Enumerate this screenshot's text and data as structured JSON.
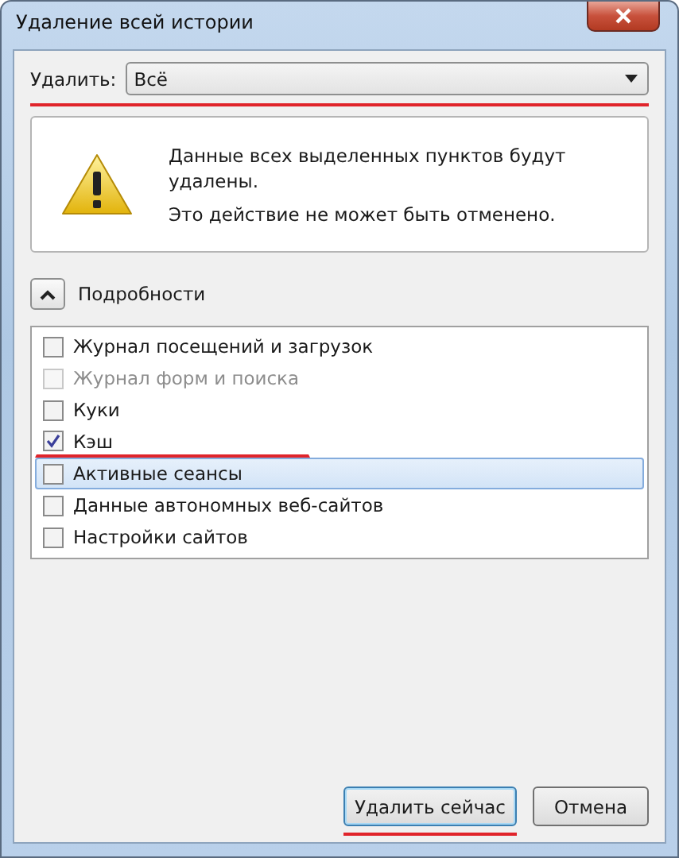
{
  "window": {
    "title": "Удаление всей истории"
  },
  "range": {
    "label": "Удалить:",
    "value": "Всё",
    "annotated": true
  },
  "warning": {
    "lines": [
      "Данные всех выделенных пунктов будут удалены.",
      "Это действие не может быть отменено."
    ]
  },
  "details": {
    "label": "Подробности",
    "expanded": true
  },
  "items": [
    {
      "label": "Журнал посещений и загрузок",
      "checked": false,
      "disabled": false,
      "selected": false,
      "annotated": false
    },
    {
      "label": "Журнал форм и поиска",
      "checked": false,
      "disabled": true,
      "selected": false,
      "annotated": false
    },
    {
      "label": "Куки",
      "checked": false,
      "disabled": false,
      "selected": false,
      "annotated": false
    },
    {
      "label": "Кэш",
      "checked": true,
      "disabled": false,
      "selected": false,
      "annotated": true
    },
    {
      "label": "Активные сеансы",
      "checked": false,
      "disabled": false,
      "selected": true,
      "annotated": false
    },
    {
      "label": "Данные автономных веб-сайтов",
      "checked": false,
      "disabled": false,
      "selected": false,
      "annotated": false
    },
    {
      "label": "Настройки сайтов",
      "checked": false,
      "disabled": false,
      "selected": false,
      "annotated": false
    }
  ],
  "buttons": [
    {
      "label": "Удалить сейчас",
      "default": true,
      "annotated": true
    },
    {
      "label": "Отмена",
      "default": false,
      "annotated": false
    }
  ]
}
